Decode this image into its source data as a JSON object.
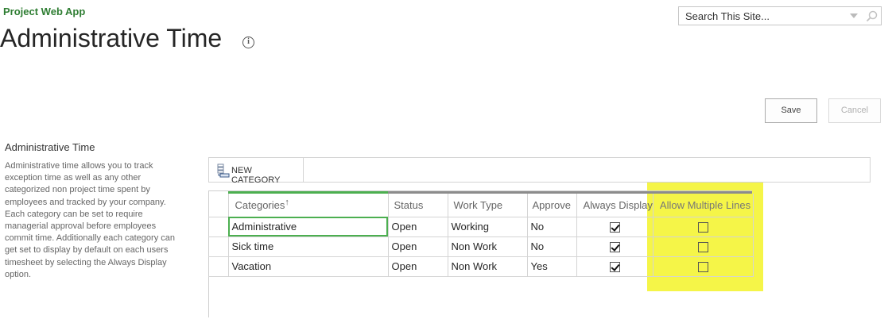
{
  "header": {
    "app_name": "Project Web App",
    "page_title": "Administrative Time",
    "info_icon": "info-icon"
  },
  "search": {
    "placeholder": "Search This Site...",
    "icon": "magnifier-icon"
  },
  "actions": {
    "save_label": "Save",
    "cancel_label": "Cancel"
  },
  "section": {
    "title": "Administrative Time",
    "description": "Administrative time allows you to track exception time as well as any other categorized non project time spent by employees and tracked by your company. Each category can be set to require managerial approval before employees commit time. Additionally each category can get set to display by default on each users timesheet by selecting the Always Display option."
  },
  "toolbar": {
    "new_category_label": "NEW CATEGORY",
    "new_category_icon": "new-row-icon"
  },
  "grid": {
    "columns": [
      "Categories",
      "Status",
      "Work Type",
      "Approve",
      "Always Display",
      "Allow Multiple Lines"
    ],
    "sort_indicator": "↑",
    "rows": [
      {
        "category": "Administrative",
        "status": "Open",
        "work_type": "Working",
        "approve": "No",
        "always_display": true,
        "allow_multiple_lines": false
      },
      {
        "category": "Sick time",
        "status": "Open",
        "work_type": "Non Work",
        "approve": "No",
        "always_display": true,
        "allow_multiple_lines": false
      },
      {
        "category": "Vacation",
        "status": "Open",
        "work_type": "Non Work",
        "approve": "Yes",
        "always_display": true,
        "allow_multiple_lines": false
      }
    ]
  },
  "colors": {
    "brand_green": "#2e7d32",
    "grid_focus_green": "#4caf50",
    "highlight_yellow": "#f5f548"
  }
}
